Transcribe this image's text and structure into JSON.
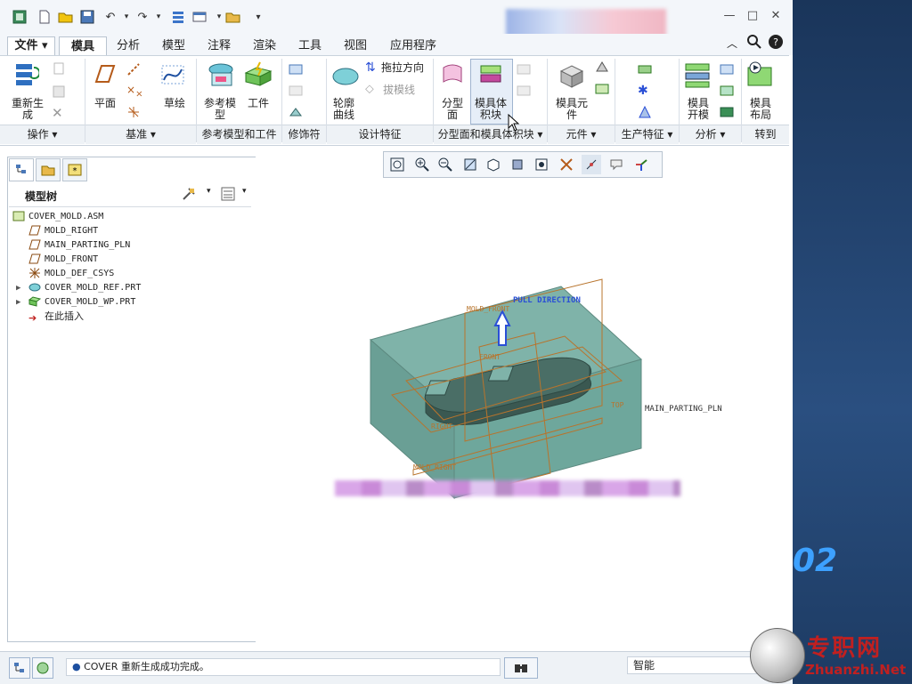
{
  "window": {
    "title_right": "",
    "controls": {
      "minimize": "—",
      "maximize": "□",
      "close": "✕"
    }
  },
  "quick_access": [
    "app-icon",
    "new-icon",
    "open-icon",
    "save-icon",
    "undo-icon",
    "redo-icon",
    "regenerate-icon",
    "windows-icon",
    "folder-icon",
    "customize-icon"
  ],
  "tabs": {
    "file": "文件",
    "items": [
      "模具",
      "分析",
      "模型",
      "注释",
      "渲染",
      "工具",
      "视图",
      "应用程序"
    ],
    "active": "模具"
  },
  "ribbon": {
    "regenerate": "重新生\n成",
    "plane": "平面",
    "sketch": "草绘",
    "ref_model": "参考模\n型",
    "workpiece": "工件",
    "contour_curve": "轮廓\n曲线",
    "drag_direction": "拖拉方向",
    "draft_line": "拔模线",
    "parting_surface": "分型\n面",
    "mold_volume": "模具体\n积块",
    "mold_component": "模具元\n件",
    "mold_open": "模具\n开模",
    "mold_layout": "模具\n布局",
    "groups": {
      "operations": "操作",
      "datum": "基准",
      "ref_model_workpiece": "参考模型和工件",
      "modifiers": "修饰符",
      "design_features": "设计特征",
      "parting_volume": "分型面和模具体积块",
      "components": "元件",
      "production": "生产特征",
      "analysis": "分析",
      "goto": "转到"
    }
  },
  "model_tree": {
    "title": "模型树",
    "items": [
      {
        "label": "COVER_MOLD.ASM",
        "icon": "assembly-icon"
      },
      {
        "label": "MOLD_RIGHT",
        "icon": "datum-plane-icon"
      },
      {
        "label": "MAIN_PARTING_PLN",
        "icon": "datum-plane-icon"
      },
      {
        "label": "MOLD_FRONT",
        "icon": "datum-plane-icon"
      },
      {
        "label": "MOLD_DEF_CSYS",
        "icon": "csys-icon"
      },
      {
        "label": "COVER_MOLD_REF.PRT",
        "icon": "ref-part-icon"
      },
      {
        "label": "COVER_MOLD_WP.PRT",
        "icon": "workpiece-icon"
      },
      {
        "label": "在此插入",
        "icon": "insert-here-icon"
      }
    ]
  },
  "viewport_labels": {
    "pull_direction": "PULL DIRECTION",
    "mold_front": "MOLD_FRONT",
    "front": "FRONT",
    "top": "TOP",
    "main_parting_pln": "MAIN_PARTING_PLN",
    "mold_right": "MOLD_RIGHT",
    "right": "RIGHT"
  },
  "status": {
    "message": "COVER 重新生成成功完成。",
    "filter": "智能"
  },
  "desktop": {
    "number": "02",
    "watermark_cn": "专职网",
    "watermark_en": "Zhuanzhi.Net"
  },
  "colors": {
    "workpiece": "#6ea79c",
    "datum": "#b8742c",
    "pull_dir": "#2a4fd6",
    "accent": "#1d73c9"
  }
}
